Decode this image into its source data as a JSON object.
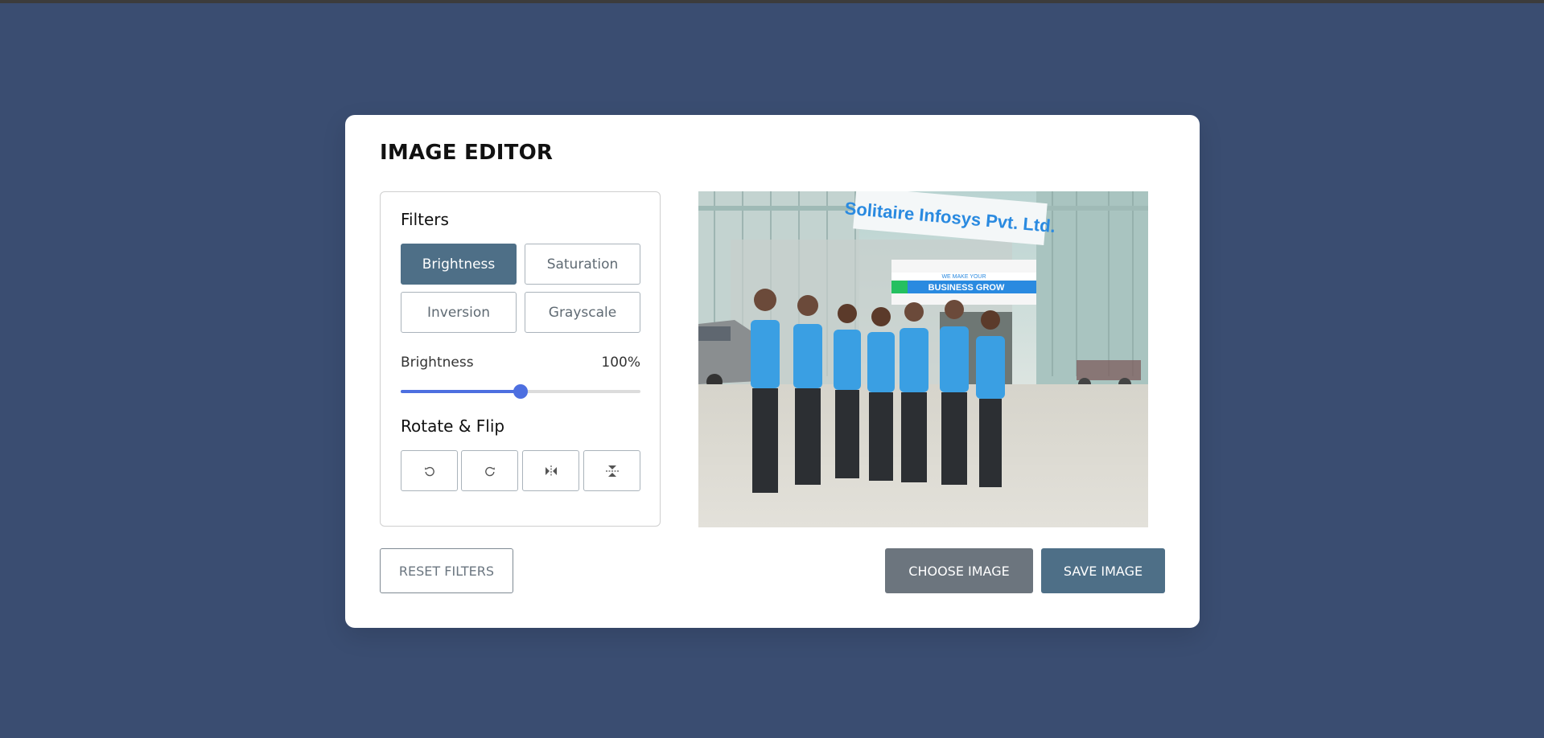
{
  "title": "IMAGE EDITOR",
  "filters": {
    "heading": "Filters",
    "options": [
      "Brightness",
      "Saturation",
      "Inversion",
      "Grayscale"
    ],
    "active": "Brightness"
  },
  "slider": {
    "label": "Brightness",
    "value_text": "100%",
    "fraction": 0.5
  },
  "rotate": {
    "heading": "Rotate & Flip",
    "icons": [
      "rotate-left-icon",
      "rotate-right-icon",
      "flip-horizontal-icon",
      "flip-vertical-icon"
    ]
  },
  "photo": {
    "sign_text": "Solitaire Infosys Pvt. Ltd.",
    "banner_small": "WE MAKE YOUR",
    "banner_big": "BUSINESS GROW"
  },
  "buttons": {
    "reset": "RESET FILTERS",
    "choose": "CHOOSE IMAGE",
    "save": "SAVE IMAGE"
  },
  "colors": {
    "background": "#3a4d71",
    "accent": "#4e6f87",
    "slider": "#4d6fe0",
    "choose_button": "#6c757e"
  }
}
